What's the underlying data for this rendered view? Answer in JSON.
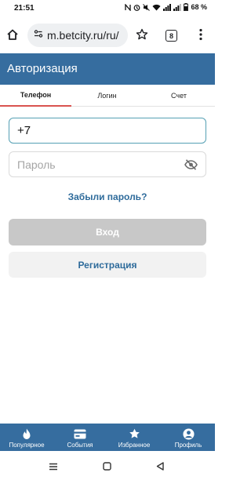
{
  "status_bar": {
    "time": "21:51",
    "battery": "68 %"
  },
  "browser": {
    "url": "m.betcity.ru/ru/",
    "tab_count": "8"
  },
  "header": {
    "title": "Авторизация"
  },
  "tabs": [
    {
      "label": "Телефон",
      "active": true
    },
    {
      "label": "Логин",
      "active": false
    },
    {
      "label": "Счет",
      "active": false
    }
  ],
  "form": {
    "phone_value": "+7",
    "password_placeholder": "Пароль",
    "forgot_password": "Забыли пароль?",
    "login_button": "Вход",
    "register_button": "Регистрация"
  },
  "bottom_nav": [
    {
      "label": "Популярное",
      "icon": "fire-icon"
    },
    {
      "label": "События",
      "icon": "card-icon"
    },
    {
      "label": "Избранное",
      "icon": "star-icon"
    },
    {
      "label": "Профиль",
      "icon": "user-icon"
    }
  ],
  "colors": {
    "brand": "#366d9f",
    "link": "#2e6b9b",
    "active_tab_underline": "#d9534f",
    "disabled_button": "#c8c8c8"
  }
}
